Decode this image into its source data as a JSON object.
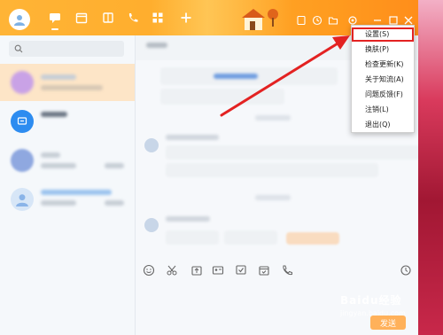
{
  "menu": {
    "items": [
      {
        "label": "设置(S)"
      },
      {
        "label": "换肤(P)"
      },
      {
        "label": "检查更新(K)"
      },
      {
        "label": "关于知流(A)"
      },
      {
        "label": "问题反馈(F)"
      },
      {
        "label": "注销(L)"
      },
      {
        "label": "退出(Q)"
      }
    ]
  },
  "compose": {
    "send_label": "发送"
  },
  "watermark": {
    "line1": "Baidu经验",
    "line2": "jingyan.baidu.com"
  },
  "colors": {
    "title_bar": "#ffad2c",
    "sidebar_selected": "#fde5c7",
    "accent_blue": "#2d8cf0",
    "arrow_red": "#e32222"
  },
  "icons": {
    "toolbar": [
      "message-icon",
      "calendar-icon",
      "apps-icon",
      "phone-icon",
      "grid-icon",
      "plus-icon"
    ],
    "window": [
      "minimize-icon",
      "maximize-icon",
      "close-icon"
    ]
  }
}
